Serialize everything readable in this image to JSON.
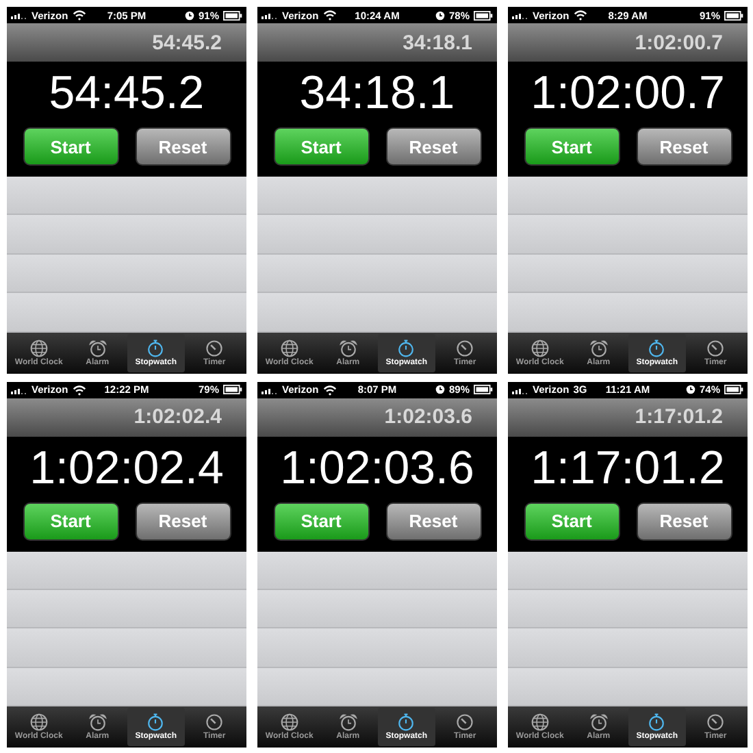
{
  "phones": [
    {
      "status": {
        "carrier": "Verizon",
        "network": {
          "kind": "wifi"
        },
        "time": "7:05 PM",
        "alarm": true,
        "battery": "91%"
      },
      "lap_time": "54:45.2",
      "time": "54:45.2",
      "buttons": [
        {
          "label": "Start",
          "kind": "start"
        },
        {
          "label": "Reset",
          "kind": "reset"
        }
      ],
      "tabs": [
        {
          "label": "World Clock",
          "kind": "globe",
          "selected": false
        },
        {
          "label": "Alarm",
          "kind": "alarm",
          "selected": false
        },
        {
          "label": "Stopwatch",
          "kind": "stopwatch",
          "selected": true
        },
        {
          "label": "Timer",
          "kind": "timer",
          "selected": false
        }
      ]
    },
    {
      "status": {
        "carrier": "Verizon",
        "network": {
          "kind": "wifi"
        },
        "time": "10:24 AM",
        "alarm": true,
        "battery": "78%"
      },
      "lap_time": "34:18.1",
      "time": "34:18.1",
      "buttons": [
        {
          "label": "Start",
          "kind": "start"
        },
        {
          "label": "Reset",
          "kind": "reset"
        }
      ],
      "tabs": [
        {
          "label": "World Clock",
          "kind": "globe",
          "selected": false
        },
        {
          "label": "Alarm",
          "kind": "alarm",
          "selected": false
        },
        {
          "label": "Stopwatch",
          "kind": "stopwatch",
          "selected": true
        },
        {
          "label": "Timer",
          "kind": "timer",
          "selected": false
        }
      ]
    },
    {
      "status": {
        "carrier": "Verizon",
        "network": {
          "kind": "wifi"
        },
        "time": "8:29 AM",
        "alarm": false,
        "battery": "91%"
      },
      "lap_time": "1:02:00.7",
      "time": "1:02:00.7",
      "buttons": [
        {
          "label": "Start",
          "kind": "start"
        },
        {
          "label": "Reset",
          "kind": "reset"
        }
      ],
      "tabs": [
        {
          "label": "World Clock",
          "kind": "globe",
          "selected": false
        },
        {
          "label": "Alarm",
          "kind": "alarm",
          "selected": false
        },
        {
          "label": "Stopwatch",
          "kind": "stopwatch",
          "selected": true
        },
        {
          "label": "Timer",
          "kind": "timer",
          "selected": false
        }
      ]
    },
    {
      "status": {
        "carrier": "Verizon",
        "network": {
          "kind": "wifi"
        },
        "time": "12:22 PM",
        "alarm": false,
        "battery": "79%"
      },
      "lap_time": "1:02:02.4",
      "time": "1:02:02.4",
      "buttons": [
        {
          "label": "Start",
          "kind": "start"
        },
        {
          "label": "Reset",
          "kind": "reset"
        }
      ],
      "tabs": [
        {
          "label": "World Clock",
          "kind": "globe",
          "selected": false
        },
        {
          "label": "Alarm",
          "kind": "alarm",
          "selected": false
        },
        {
          "label": "Stopwatch",
          "kind": "stopwatch",
          "selected": true
        },
        {
          "label": "Timer",
          "kind": "timer",
          "selected": false
        }
      ]
    },
    {
      "status": {
        "carrier": "Verizon",
        "network": {
          "kind": "wifi"
        },
        "time": "8:07 PM",
        "alarm": true,
        "battery": "89%"
      },
      "lap_time": "1:02:03.6",
      "time": "1:02:03.6",
      "buttons": [
        {
          "label": "Start",
          "kind": "start"
        },
        {
          "label": "Reset",
          "kind": "reset"
        }
      ],
      "tabs": [
        {
          "label": "World Clock",
          "kind": "globe",
          "selected": false
        },
        {
          "label": "Alarm",
          "kind": "alarm",
          "selected": false
        },
        {
          "label": "Stopwatch",
          "kind": "stopwatch",
          "selected": true
        },
        {
          "label": "Timer",
          "kind": "timer",
          "selected": false
        }
      ]
    },
    {
      "status": {
        "carrier": "Verizon",
        "network": {
          "kind": "text",
          "label": "3G"
        },
        "time": "11:21 AM",
        "alarm": true,
        "battery": "74%"
      },
      "lap_time": "1:17:01.2",
      "time": "1:17:01.2",
      "buttons": [
        {
          "label": "Start",
          "kind": "start"
        },
        {
          "label": "Reset",
          "kind": "reset"
        }
      ],
      "tabs": [
        {
          "label": "World Clock",
          "kind": "globe",
          "selected": false
        },
        {
          "label": "Alarm",
          "kind": "alarm",
          "selected": false
        },
        {
          "label": "Stopwatch",
          "kind": "stopwatch",
          "selected": true
        },
        {
          "label": "Timer",
          "kind": "timer",
          "selected": false
        }
      ]
    }
  ]
}
